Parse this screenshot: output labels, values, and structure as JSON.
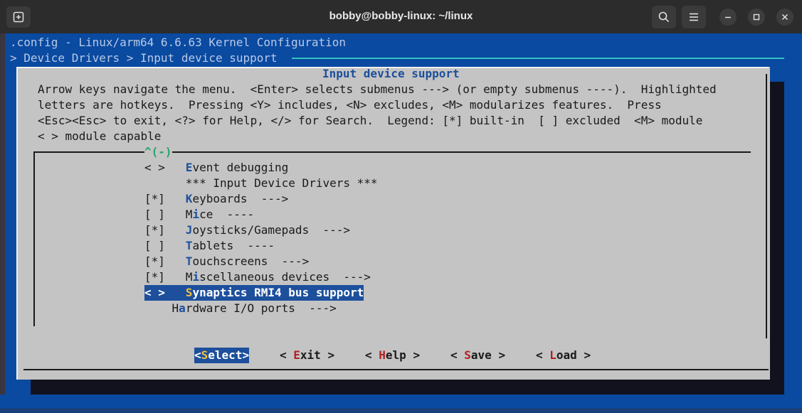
{
  "window": {
    "title": "bobby@bobby-linux: ~/linux"
  },
  "header": {
    "config_line": ".config - Linux/arm64 6.6.63 Kernel Configuration",
    "breadcrumb": "> Device Drivers > Input device support"
  },
  "dialog": {
    "title": "Input device support",
    "help_lines": [
      "Arrow keys navigate the menu.  <Enter> selects submenus ---> (or empty submenus ----).  Highlighted",
      "letters are hotkeys.  Pressing <Y> includes, <N> excludes, <M> modularizes features.  Press",
      "<Esc><Esc> to exit, <?> for Help, </> for Search.  Legend: [*] built-in  [ ] excluded  <M> module",
      "< > module capable"
    ],
    "scroll_indicator": "^(-)"
  },
  "menu": {
    "items": [
      {
        "prefix": "< >   ",
        "hotkey": "E",
        "rest": "vent debugging",
        "selected": false
      },
      {
        "prefix": "      ",
        "hotkey": "",
        "rest": "*** Input Device Drivers ***",
        "selected": false
      },
      {
        "prefix": "[*]   ",
        "hotkey": "K",
        "rest": "eyboards  --->",
        "selected": false
      },
      {
        "prefix": "[ ]   ",
        "pre": "M",
        "hotkey": "i",
        "rest": "ce  ----",
        "selected": false
      },
      {
        "prefix": "[*]   ",
        "hotkey": "J",
        "rest": "oysticks/Gamepads  --->",
        "selected": false
      },
      {
        "prefix": "[ ]   ",
        "hotkey": "T",
        "rest": "ablets  ----",
        "selected": false
      },
      {
        "prefix": "[*]   ",
        "hotkey": "T",
        "rest": "ouchscreens  --->",
        "selected": false
      },
      {
        "prefix": "[*]   ",
        "pre": "M",
        "hotkey": "i",
        "rest": "scellaneous devices  --->",
        "selected": false
      },
      {
        "prefix": "< >   ",
        "hotkey": "S",
        "rest": "ynaptics RMI4 bus support",
        "selected": true
      },
      {
        "prefix": "    ",
        "pre": "H",
        "hotkey": "a",
        "rest": "rdware I/O ports  --->",
        "selected": false
      }
    ]
  },
  "buttons": {
    "select": {
      "open": "<",
      "hotkey": "S",
      "rest": "elect",
      "close": ">"
    },
    "exit": {
      "open": "< ",
      "hotkey": "E",
      "rest": "xit",
      "close": " >"
    },
    "help": {
      "open": "< ",
      "hotkey": "H",
      "rest": "elp",
      "close": " >"
    },
    "save": {
      "open": "< ",
      "hotkey": "S",
      "rest": "ave",
      "close": " >"
    },
    "load": {
      "open": "< ",
      "hotkey": "L",
      "rest": "oad",
      "close": " >"
    }
  }
}
